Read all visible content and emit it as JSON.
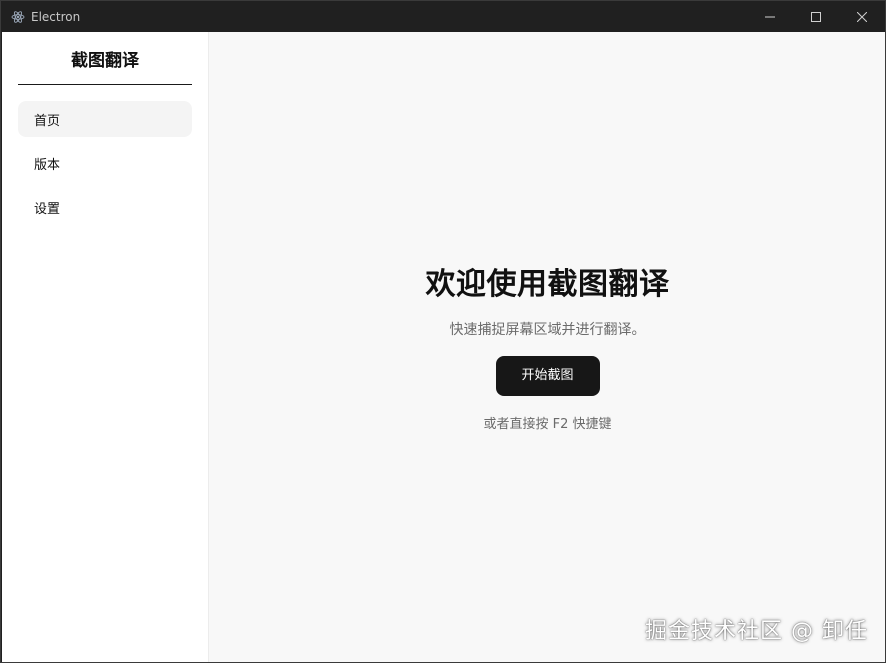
{
  "window": {
    "title": "Electron",
    "controls": {
      "minimize_icon": "minimize-icon",
      "maximize_icon": "maximize-icon",
      "close_icon": "close-icon"
    }
  },
  "sidebar": {
    "title": "截图翻译",
    "items": [
      {
        "label": "首页",
        "active": true
      },
      {
        "label": "版本",
        "active": false
      },
      {
        "label": "设置",
        "active": false
      }
    ]
  },
  "main": {
    "title": "欢迎使用截图翻译",
    "subtitle": "快速捕捉屏幕区域并进行翻译。",
    "start_button": "开始截图",
    "hint": "或者直接按 F2 快捷键"
  },
  "watermark": "掘金技术社区 @ 卸任",
  "colors": {
    "titlebar": "#202020",
    "sidebar_bg": "#ffffff",
    "main_bg": "#f8f8f8",
    "primary_button": "#171717",
    "active_nav": "#f4f4f4"
  }
}
